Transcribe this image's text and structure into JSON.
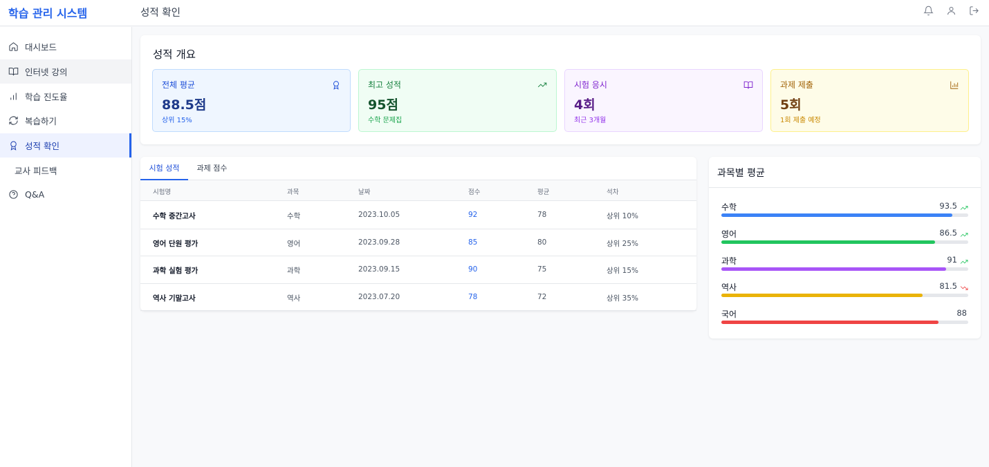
{
  "header": {
    "brand": "학습 관리 시스템",
    "page_title": "성적 확인",
    "icons": [
      "bell-icon",
      "user-icon",
      "logout-icon"
    ]
  },
  "sidebar": {
    "items": [
      {
        "label": "대시보드",
        "icon": "home-icon"
      },
      {
        "label": "인터넷 강의",
        "icon": "book-icon"
      },
      {
        "label": "학습 진도율",
        "icon": "bar-chart-icon"
      },
      {
        "label": "복습하기",
        "icon": "refresh-icon"
      },
      {
        "label": "성적 확인",
        "icon": "award-icon",
        "active": true
      },
      {
        "label": "교사 피드백",
        "icon": ""
      },
      {
        "label": "Q&A",
        "icon": "help-circle-icon"
      }
    ]
  },
  "overview": {
    "title": "성적 개요",
    "stats": [
      {
        "label": "전체 평균",
        "value": "88.5점",
        "sub": "상위 15%",
        "icon": "award-icon",
        "bg": "#eff6ff",
        "border": "#bfdbfe",
        "label_color": "#1d4ed8",
        "value_color": "#1e3a8a",
        "sub_color": "#2563eb"
      },
      {
        "label": "최고 성적",
        "value": "95점",
        "sub": "수학 문제집",
        "icon": "trending-up-icon",
        "bg": "#f0fdf4",
        "border": "#bbf7d0",
        "label_color": "#15803d",
        "value_color": "#14532d",
        "sub_color": "#16a34a"
      },
      {
        "label": "시험 응시",
        "value": "4회",
        "sub": "최근 3개월",
        "icon": "book-open-icon",
        "bg": "#faf5ff",
        "border": "#e9d5ff",
        "label_color": "#7e22ce",
        "value_color": "#581c87",
        "sub_color": "#9333ea"
      },
      {
        "label": "과제 제출",
        "value": "5회",
        "sub": "1회 제출 예정",
        "icon": "bar-chart-icon",
        "bg": "#fefce8",
        "border": "#fef08a",
        "label_color": "#a16207",
        "value_color": "#713f12",
        "sub_color": "#ca8a04"
      }
    ]
  },
  "exam": {
    "tabs": [
      "시험 성적",
      "과제 점수"
    ],
    "columns": [
      "시험명",
      "과목",
      "날짜",
      "점수",
      "평균",
      "석차"
    ],
    "rows": [
      {
        "name": "수학 중간고사",
        "subject": "수학",
        "date": "2023.10.05",
        "score": "92",
        "avg": "78",
        "rank": "상위 10%"
      },
      {
        "name": "영어 단원 평가",
        "subject": "영어",
        "date": "2023.09.28",
        "score": "85",
        "avg": "80",
        "rank": "상위 25%"
      },
      {
        "name": "과학 실험 평가",
        "subject": "과학",
        "date": "2023.09.15",
        "score": "90",
        "avg": "75",
        "rank": "상위 15%"
      },
      {
        "name": "역사 기말고사",
        "subject": "역사",
        "date": "2023.07.20",
        "score": "78",
        "avg": "72",
        "rank": "상위 35%"
      }
    ]
  },
  "subjects": {
    "title": "과목별 평균",
    "items": [
      {
        "name": "수학",
        "value": 93.5,
        "label": "93.5",
        "trend": "up",
        "color": "#3b82f6"
      },
      {
        "name": "영어",
        "value": 86.5,
        "label": "86.5",
        "trend": "up",
        "color": "#22c55e"
      },
      {
        "name": "과학",
        "value": 91,
        "label": "91",
        "trend": "up",
        "color": "#a855f7"
      },
      {
        "name": "역사",
        "value": 81.5,
        "label": "81.5",
        "trend": "down",
        "color": "#eab308"
      },
      {
        "name": "국어",
        "value": 88,
        "label": "88",
        "trend": "",
        "color": "#ef4444"
      }
    ],
    "max": 100,
    "trend_up_color": "#22c55e",
    "trend_down_color": "#ef4444"
  }
}
